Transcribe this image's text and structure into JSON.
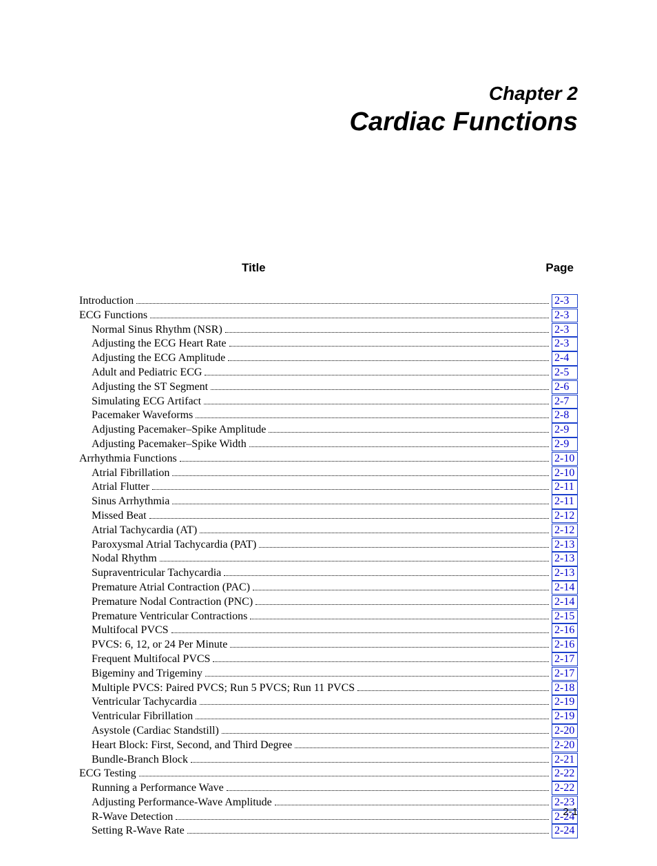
{
  "chapter": {
    "number": "Chapter 2",
    "title": "Cardiac Functions"
  },
  "columns": {
    "title": "Title",
    "page": "Page"
  },
  "toc": [
    {
      "level": 0,
      "title": "Introduction",
      "page": "2-3"
    },
    {
      "level": 0,
      "title": "ECG Functions",
      "page": "2-3"
    },
    {
      "level": 1,
      "title": "Normal Sinus Rhythm (NSR)",
      "page": "2-3"
    },
    {
      "level": 1,
      "title": "Adjusting the ECG Heart Rate",
      "page": "2-3"
    },
    {
      "level": 1,
      "title": "Adjusting the ECG Amplitude",
      "page": "2-4"
    },
    {
      "level": 1,
      "title": "Adult and Pediatric ECG",
      "page": "2-5"
    },
    {
      "level": 1,
      "title": "Adjusting the ST Segment",
      "page": "2-6"
    },
    {
      "level": 1,
      "title": "Simulating ECG Artifact",
      "page": "2-7"
    },
    {
      "level": 1,
      "title": "Pacemaker Waveforms",
      "page": "2-8"
    },
    {
      "level": 1,
      "title": "Adjusting Pacemaker–Spike Amplitude",
      "page": "2-9"
    },
    {
      "level": 1,
      "title": "Adjusting Pacemaker–Spike Width",
      "page": "2-9"
    },
    {
      "level": 0,
      "title": "Arrhythmia Functions",
      "page": "2-10"
    },
    {
      "level": 1,
      "title": "Atrial Fibrillation",
      "page": "2-10"
    },
    {
      "level": 1,
      "title": "Atrial Flutter",
      "page": "2-11"
    },
    {
      "level": 1,
      "title": "Sinus Arrhythmia",
      "page": "2-11"
    },
    {
      "level": 1,
      "title": "Missed Beat",
      "page": "2-12"
    },
    {
      "level": 1,
      "title": "Atrial Tachycardia (AT)",
      "page": "2-12"
    },
    {
      "level": 1,
      "title": "Paroxysmal Atrial Tachycardia (PAT)",
      "page": "2-13"
    },
    {
      "level": 1,
      "title": "Nodal Rhythm",
      "page": "2-13"
    },
    {
      "level": 1,
      "title": "Supraventricular Tachycardia",
      "page": "2-13"
    },
    {
      "level": 1,
      "title": "Premature Atrial Contraction (PAC)",
      "page": "2-14"
    },
    {
      "level": 1,
      "title": "Premature Nodal Contraction (PNC)",
      "page": "2-14"
    },
    {
      "level": 1,
      "title": "Premature Ventricular Contractions",
      "page": "2-15"
    },
    {
      "level": 1,
      "title": "Multifocal PVCS",
      "page": "2-16"
    },
    {
      "level": 1,
      "title": "PVCS: 6, 12, or 24 Per Minute",
      "page": "2-16"
    },
    {
      "level": 1,
      "title": "Frequent Multifocal PVCS",
      "page": "2-17"
    },
    {
      "level": 1,
      "title": "Bigeminy and Trigeminy",
      "page": "2-17"
    },
    {
      "level": 1,
      "title": "Multiple PVCS: Paired PVCS; Run 5 PVCS; Run 11 PVCS",
      "page": "2-18"
    },
    {
      "level": 1,
      "title": "Ventricular Tachycardia",
      "page": "2-19"
    },
    {
      "level": 1,
      "title": "Ventricular Fibrillation",
      "page": "2-19"
    },
    {
      "level": 1,
      "title": "Asystole (Cardiac Standstill)",
      "page": "2-20"
    },
    {
      "level": 1,
      "title": "Heart Block: First, Second, and Third Degree",
      "page": "2-20"
    },
    {
      "level": 1,
      "title": "Bundle-Branch Block",
      "page": "2-21"
    },
    {
      "level": 0,
      "title": "ECG Testing",
      "page": "2-22"
    },
    {
      "level": 1,
      "title": "Running a Performance Wave",
      "page": "2-22"
    },
    {
      "level": 1,
      "title": "Adjusting Performance-Wave Amplitude",
      "page": "2-23"
    },
    {
      "level": 1,
      "title": "R-Wave Detection",
      "page": "2-24"
    },
    {
      "level": 1,
      "title": "Setting R-Wave Rate",
      "page": "2-24"
    }
  ],
  "footer": {
    "pagenum": "2-1"
  }
}
